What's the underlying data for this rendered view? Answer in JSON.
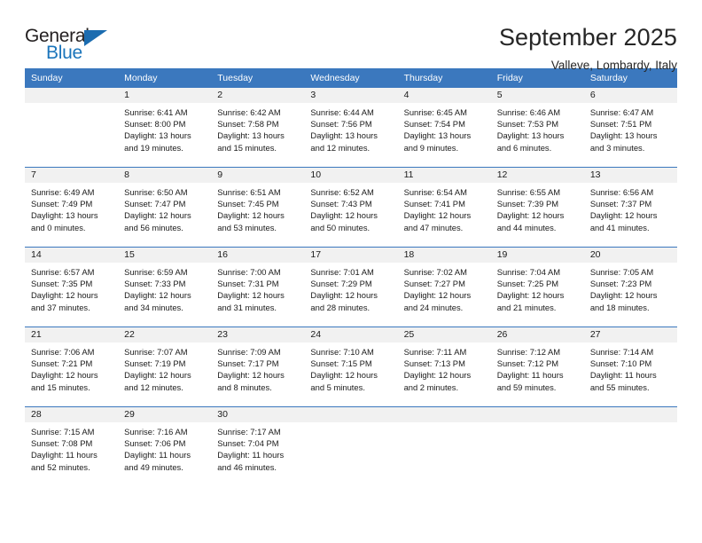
{
  "brand": {
    "name_top": "General",
    "name_bottom": "Blue",
    "accent_color": "#1b6cb0",
    "triangle_icon": "triangle-icon"
  },
  "header": {
    "title": "September 2025",
    "location": "Valleve, Lombardy, Italy"
  },
  "calendar": {
    "header_bg": "#3b78be",
    "header_text_color": "#ffffff",
    "daynum_band_bg": "#f1f1f1",
    "weekday_headers": [
      "Sunday",
      "Monday",
      "Tuesday",
      "Wednesday",
      "Thursday",
      "Friday",
      "Saturday"
    ],
    "weeks": [
      [
        {
          "day": "",
          "empty": true
        },
        {
          "day": "1",
          "sunrise": "Sunrise: 6:41 AM",
          "sunset": "Sunset: 8:00 PM",
          "daylight": "Daylight: 13 hours and 19 minutes."
        },
        {
          "day": "2",
          "sunrise": "Sunrise: 6:42 AM",
          "sunset": "Sunset: 7:58 PM",
          "daylight": "Daylight: 13 hours and 15 minutes."
        },
        {
          "day": "3",
          "sunrise": "Sunrise: 6:44 AM",
          "sunset": "Sunset: 7:56 PM",
          "daylight": "Daylight: 13 hours and 12 minutes."
        },
        {
          "day": "4",
          "sunrise": "Sunrise: 6:45 AM",
          "sunset": "Sunset: 7:54 PM",
          "daylight": "Daylight: 13 hours and 9 minutes."
        },
        {
          "day": "5",
          "sunrise": "Sunrise: 6:46 AM",
          "sunset": "Sunset: 7:53 PM",
          "daylight": "Daylight: 13 hours and 6 minutes."
        },
        {
          "day": "6",
          "sunrise": "Sunrise: 6:47 AM",
          "sunset": "Sunset: 7:51 PM",
          "daylight": "Daylight: 13 hours and 3 minutes."
        }
      ],
      [
        {
          "day": "7",
          "sunrise": "Sunrise: 6:49 AM",
          "sunset": "Sunset: 7:49 PM",
          "daylight": "Daylight: 13 hours and 0 minutes."
        },
        {
          "day": "8",
          "sunrise": "Sunrise: 6:50 AM",
          "sunset": "Sunset: 7:47 PM",
          "daylight": "Daylight: 12 hours and 56 minutes."
        },
        {
          "day": "9",
          "sunrise": "Sunrise: 6:51 AM",
          "sunset": "Sunset: 7:45 PM",
          "daylight": "Daylight: 12 hours and 53 minutes."
        },
        {
          "day": "10",
          "sunrise": "Sunrise: 6:52 AM",
          "sunset": "Sunset: 7:43 PM",
          "daylight": "Daylight: 12 hours and 50 minutes."
        },
        {
          "day": "11",
          "sunrise": "Sunrise: 6:54 AM",
          "sunset": "Sunset: 7:41 PM",
          "daylight": "Daylight: 12 hours and 47 minutes."
        },
        {
          "day": "12",
          "sunrise": "Sunrise: 6:55 AM",
          "sunset": "Sunset: 7:39 PM",
          "daylight": "Daylight: 12 hours and 44 minutes."
        },
        {
          "day": "13",
          "sunrise": "Sunrise: 6:56 AM",
          "sunset": "Sunset: 7:37 PM",
          "daylight": "Daylight: 12 hours and 41 minutes."
        }
      ],
      [
        {
          "day": "14",
          "sunrise": "Sunrise: 6:57 AM",
          "sunset": "Sunset: 7:35 PM",
          "daylight": "Daylight: 12 hours and 37 minutes."
        },
        {
          "day": "15",
          "sunrise": "Sunrise: 6:59 AM",
          "sunset": "Sunset: 7:33 PM",
          "daylight": "Daylight: 12 hours and 34 minutes."
        },
        {
          "day": "16",
          "sunrise": "Sunrise: 7:00 AM",
          "sunset": "Sunset: 7:31 PM",
          "daylight": "Daylight: 12 hours and 31 minutes."
        },
        {
          "day": "17",
          "sunrise": "Sunrise: 7:01 AM",
          "sunset": "Sunset: 7:29 PM",
          "daylight": "Daylight: 12 hours and 28 minutes."
        },
        {
          "day": "18",
          "sunrise": "Sunrise: 7:02 AM",
          "sunset": "Sunset: 7:27 PM",
          "daylight": "Daylight: 12 hours and 24 minutes."
        },
        {
          "day": "19",
          "sunrise": "Sunrise: 7:04 AM",
          "sunset": "Sunset: 7:25 PM",
          "daylight": "Daylight: 12 hours and 21 minutes."
        },
        {
          "day": "20",
          "sunrise": "Sunrise: 7:05 AM",
          "sunset": "Sunset: 7:23 PM",
          "daylight": "Daylight: 12 hours and 18 minutes."
        }
      ],
      [
        {
          "day": "21",
          "sunrise": "Sunrise: 7:06 AM",
          "sunset": "Sunset: 7:21 PM",
          "daylight": "Daylight: 12 hours and 15 minutes."
        },
        {
          "day": "22",
          "sunrise": "Sunrise: 7:07 AM",
          "sunset": "Sunset: 7:19 PM",
          "daylight": "Daylight: 12 hours and 12 minutes."
        },
        {
          "day": "23",
          "sunrise": "Sunrise: 7:09 AM",
          "sunset": "Sunset: 7:17 PM",
          "daylight": "Daylight: 12 hours and 8 minutes."
        },
        {
          "day": "24",
          "sunrise": "Sunrise: 7:10 AM",
          "sunset": "Sunset: 7:15 PM",
          "daylight": "Daylight: 12 hours and 5 minutes."
        },
        {
          "day": "25",
          "sunrise": "Sunrise: 7:11 AM",
          "sunset": "Sunset: 7:13 PM",
          "daylight": "Daylight: 12 hours and 2 minutes."
        },
        {
          "day": "26",
          "sunrise": "Sunrise: 7:12 AM",
          "sunset": "Sunset: 7:12 PM",
          "daylight": "Daylight: 11 hours and 59 minutes."
        },
        {
          "day": "27",
          "sunrise": "Sunrise: 7:14 AM",
          "sunset": "Sunset: 7:10 PM",
          "daylight": "Daylight: 11 hours and 55 minutes."
        }
      ],
      [
        {
          "day": "28",
          "sunrise": "Sunrise: 7:15 AM",
          "sunset": "Sunset: 7:08 PM",
          "daylight": "Daylight: 11 hours and 52 minutes."
        },
        {
          "day": "29",
          "sunrise": "Sunrise: 7:16 AM",
          "sunset": "Sunset: 7:06 PM",
          "daylight": "Daylight: 11 hours and 49 minutes."
        },
        {
          "day": "30",
          "sunrise": "Sunrise: 7:17 AM",
          "sunset": "Sunset: 7:04 PM",
          "daylight": "Daylight: 11 hours and 46 minutes."
        },
        {
          "day": "",
          "empty": true
        },
        {
          "day": "",
          "empty": true
        },
        {
          "day": "",
          "empty": true
        },
        {
          "day": "",
          "empty": true
        }
      ]
    ]
  }
}
